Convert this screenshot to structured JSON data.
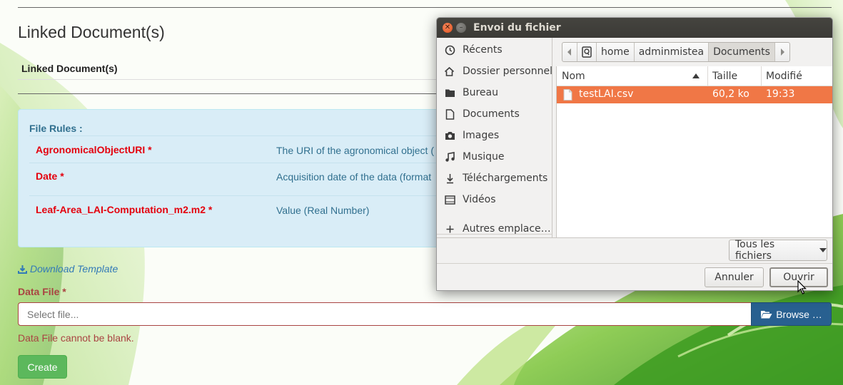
{
  "page": {
    "section_title": "Linked Document(s)",
    "linked_docs_header": "Linked Document(s)",
    "file_rules": {
      "heading": "File Rules :",
      "rules": [
        {
          "name": "AgronomicalObjectURI *",
          "description": "The URI of the agronomical object ("
        },
        {
          "name": "Date *",
          "description": "Acquisition date of the data (format"
        },
        {
          "name": "Leaf-Area_LAI-Computation_m2.m2 *",
          "description": "Value (Real Number)"
        }
      ]
    },
    "download_template": "Download Template",
    "data_file_label": "Data File *",
    "file_input_placeholder": "Select file...",
    "browse_label": "Browse …",
    "error_text": "Data File cannot be blank.",
    "create_label": "Create"
  },
  "dialog": {
    "title": "Envoi du fichier",
    "sidebar": [
      {
        "label": "Récents",
        "icon": "clock-icon"
      },
      {
        "label": "Dossier personnel",
        "icon": "home-icon"
      },
      {
        "label": "Bureau",
        "icon": "folder-icon"
      },
      {
        "label": "Documents",
        "icon": "document-icon"
      },
      {
        "label": "Images",
        "icon": "camera-icon"
      },
      {
        "label": "Musique",
        "icon": "music-icon"
      },
      {
        "label": "Téléchargements",
        "icon": "download-icon"
      },
      {
        "label": "Vidéos",
        "icon": "video-icon"
      },
      {
        "label": "Autres emplace…",
        "icon": "plus-icon"
      }
    ],
    "path": [
      "home",
      "adminmistea",
      "Documents"
    ],
    "columns": {
      "name": "Nom",
      "size": "Taille",
      "modified": "Modifié"
    },
    "files": [
      {
        "name": "testLAI.csv",
        "size": "60,2 ko",
        "modified": "19:33",
        "selected": true
      }
    ],
    "filter": "Tous les fichiers",
    "cancel_label": "Annuler",
    "open_label": "Ouvrir"
  },
  "colors": {
    "error_red": "#a94442",
    "rule_name_red": "#e4000d",
    "info_blue": "#31708f",
    "browse_blue": "#286090",
    "create_green": "#5cb85c",
    "selection_orange": "#f07746"
  }
}
